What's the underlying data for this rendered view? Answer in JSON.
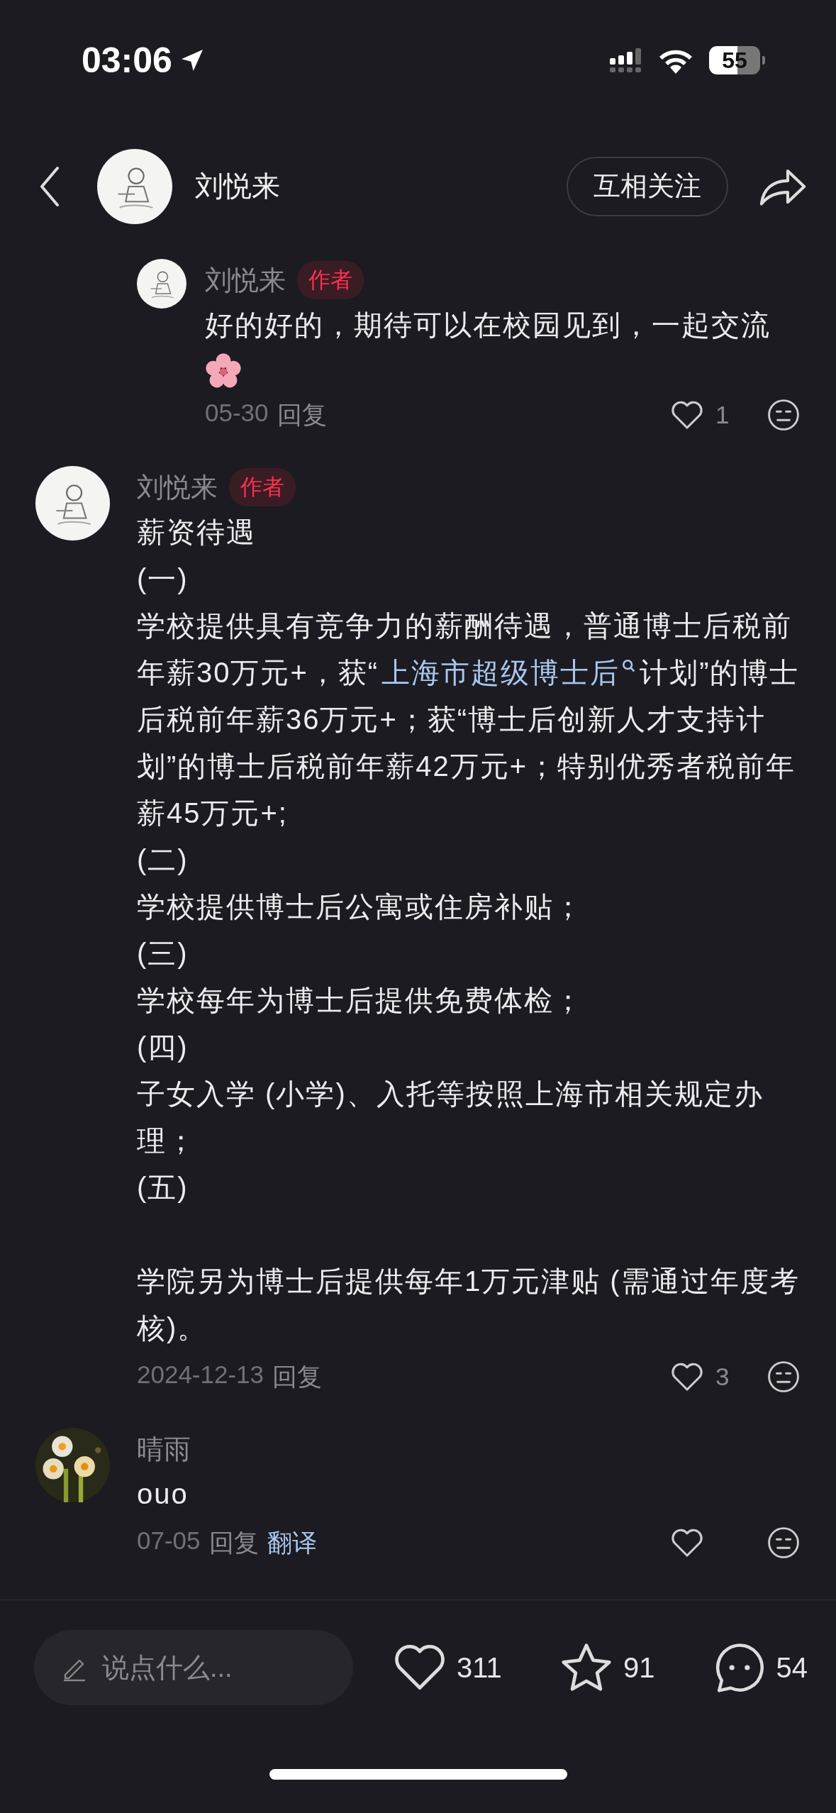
{
  "status_bar": {
    "time": "03:06",
    "battery": "55"
  },
  "header": {
    "name": "刘悦来",
    "follow_button": "互相关注"
  },
  "comments": [
    {
      "kind": "reply",
      "name": "刘悦来",
      "badge": "作者",
      "paragraphs": [
        [
          {
            "kind": "text",
            "text": "好的好的，期待可以在校园见到，一起交流"
          },
          {
            "kind": "blossom"
          }
        ]
      ],
      "date": "05-30",
      "reply": "回复",
      "likes": "1"
    },
    {
      "kind": "top",
      "name": "刘悦来",
      "badge": "作者",
      "paragraphs": [
        [
          {
            "kind": "text",
            "text": "薪资待遇"
          }
        ],
        [
          {
            "kind": "text",
            "text": "(一)"
          }
        ],
        [
          {
            "kind": "text",
            "text": "学校提供具有竞争力的薪酬待遇，普通博士后税前年薪30万元+，获“"
          },
          {
            "kind": "link",
            "text": "上海市超级博士后"
          },
          {
            "kind": "text",
            "text": "计划”的博士后税前年薪36万元+；获“博士后创新人才支持计划”的博士后税前年薪42万元+；特别优秀者税前年薪45万元+;"
          }
        ],
        [
          {
            "kind": "text",
            "text": "(二)"
          }
        ],
        [
          {
            "kind": "text",
            "text": "学校提供博士后公寓或住房补贴；"
          }
        ],
        [
          {
            "kind": "text",
            "text": "(三)"
          }
        ],
        [
          {
            "kind": "text",
            "text": "学校每年为博士后提供免费体检；"
          }
        ],
        [
          {
            "kind": "text",
            "text": "(四)"
          }
        ],
        [
          {
            "kind": "text",
            "text": "子女入学 (小学)、入托等按照上海市相关规定办理；"
          }
        ],
        [
          {
            "kind": "text",
            "text": "(五)"
          }
        ],
        [
          {
            "kind": "gap"
          },
          {
            "kind": "text",
            "text": "学院另为博士后提供每年1万元津贴 (需通过年度考核)。"
          }
        ]
      ],
      "date": "2024-12-13",
      "reply": "回复",
      "likes": "3"
    },
    {
      "kind": "top",
      "name": "晴雨",
      "paragraphs": [
        [
          {
            "kind": "text",
            "text": "ouo"
          }
        ]
      ],
      "date": "07-05",
      "reply": "回复",
      "translate": "翻译"
    }
  ],
  "composer": {
    "placeholder": "说点什么..."
  },
  "actions": [
    {
      "kind": "like",
      "count": "311"
    },
    {
      "kind": "star",
      "count": "91"
    },
    {
      "kind": "comment",
      "count": "54"
    }
  ]
}
